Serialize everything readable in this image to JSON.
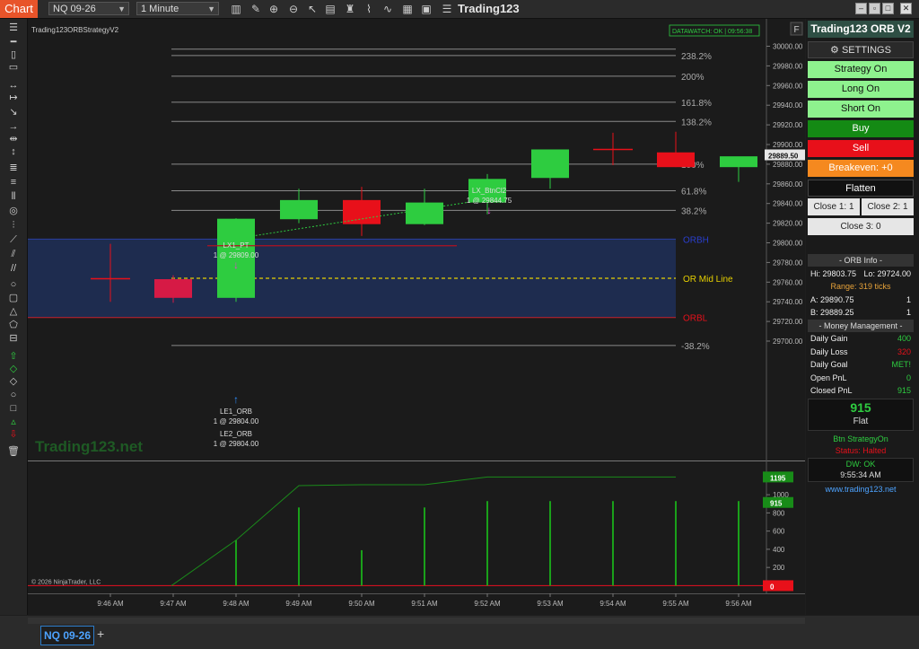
{
  "app": {
    "tab_label": "Chart",
    "instrument": "NQ 09-26",
    "interval": "1 Minute",
    "window_title": "Trading123",
    "toolbar_icons": [
      "bar-chart-icon",
      "pencil-icon",
      "zoom-in-icon",
      "zoom-out-icon",
      "cursor-icon",
      "properties-icon",
      "strategy-icon",
      "indicator-icon",
      "data-box-icon",
      "hide-icon",
      "list-icon"
    ],
    "window_buttons": [
      "–",
      "□",
      "▢",
      "✕"
    ]
  },
  "chart": {
    "indicator_label": "Trading123ORBStrategyV2",
    "datawatch": "DATAWATCH: OK | 09:56:38",
    "panel_f": "F",
    "watermark": "Trading123.net",
    "copyright": "© 2026 NinjaTrader, LLC",
    "price_ticks": [
      "30000.00",
      "29980.00",
      "29960.00",
      "29940.00",
      "29920.00",
      "29900.00",
      "29880.00",
      "29860.00",
      "29840.00",
      "29820.00",
      "29800.00",
      "29780.00",
      "29760.00",
      "29740.00",
      "29720.00",
      "29700.00"
    ],
    "last_price": "29889.50",
    "fib_levels": [
      {
        "label": "238.2%",
        "price": 29990.5
      },
      {
        "label": "200%",
        "price": 29969.5
      },
      {
        "label": "161.8%",
        "price": 29943.0
      },
      {
        "label": "138.2%",
        "price": 29923.5
      },
      {
        "label": "100%",
        "price": 29880.0
      },
      {
        "label": "61.8%",
        "price": 29853.0
      },
      {
        "label": "38.2%",
        "price": 29833.0
      },
      {
        "label": "-38.2%",
        "price": 29695.5
      }
    ],
    "or_labels": {
      "orh": "ORBH",
      "mid": "OR Mid Line",
      "orl": "ORBL"
    },
    "or_range": {
      "high": 29803.75,
      "low": 29724.0,
      "mid": 29763.9
    },
    "time_labels": [
      "9:46 AM",
      "9:47 AM",
      "9:48 AM",
      "9:49 AM",
      "9:50 AM",
      "9:51 AM",
      "9:52 AM",
      "9:53 AM",
      "9:54 AM",
      "9:55 AM",
      "9:56 AM"
    ],
    "candles": [
      {
        "t": "9:46 AM",
        "o": 29763.5,
        "h": 29799.0,
        "l": 29740.0,
        "c": 29763.5,
        "color": "doji"
      },
      {
        "t": "9:47 AM",
        "o": 29763.0,
        "h": 29767.0,
        "l": 29739.0,
        "c": 29744.0,
        "color": "red"
      },
      {
        "t": "9:48 AM",
        "o": 29744.0,
        "h": 29825.0,
        "l": 29740.0,
        "c": 29824.5,
        "color": "green"
      },
      {
        "t": "9:49 AM",
        "o": 29824.0,
        "h": 29855.0,
        "l": 29820.0,
        "c": 29843.5,
        "color": "green"
      },
      {
        "t": "9:50 AM",
        "o": 29843.5,
        "h": 29857.0,
        "l": 29807.0,
        "c": 29819.0,
        "color": "red"
      },
      {
        "t": "9:51 AM",
        "o": 29819.0,
        "h": 29855.0,
        "l": 29818.0,
        "c": 29841.0,
        "color": "green"
      },
      {
        "t": "9:52 AM",
        "o": 29841.0,
        "h": 29870.0,
        "l": 29829.0,
        "c": 29865.0,
        "color": "green"
      },
      {
        "t": "9:53 AM",
        "o": 29866.0,
        "h": 29895.0,
        "l": 29855.0,
        "c": 29895.0,
        "color": "green"
      },
      {
        "t": "9:54 AM",
        "o": 29895.0,
        "h": 29912.0,
        "l": 29879.0,
        "c": 29895.0,
        "color": "doji"
      },
      {
        "t": "9:55 AM",
        "o": 29892.0,
        "h": 29913.0,
        "l": 29877.0,
        "c": 29877.0,
        "color": "red"
      },
      {
        "t": "9:56 AM",
        "o": 29877.0,
        "h": 29887.0,
        "l": 29862.0,
        "c": 29888.0,
        "color": "green"
      }
    ],
    "trade_labels": {
      "lx1_title": "LX1_PT",
      "lx1_detail": "1 @ 29809.00",
      "lx_title": "LX_BtnCl2",
      "lx_detail": "1 @ 29844.75",
      "le1_title": "LE1_ORB",
      "le1_detail": "1 @ 29804.00",
      "le2_title": "LE2_ORB",
      "le2_detail": "1 @ 29804.00"
    },
    "pnl_ticks": [
      "1000",
      "800",
      "600",
      "400",
      "200"
    ],
    "pnl_badges": {
      "top": "1195",
      "cur": "915",
      "zero": "0"
    },
    "pnl_bars": [
      {
        "t": "9:48 AM",
        "v": 500
      },
      {
        "t": "9:49 AM",
        "v": 860
      },
      {
        "t": "9:50 AM",
        "v": 390
      },
      {
        "t": "9:51 AM",
        "v": 860
      },
      {
        "t": "9:52 AM",
        "v": 930
      },
      {
        "t": "9:53 AM",
        "v": 930
      },
      {
        "t": "9:54 AM",
        "v": 930
      },
      {
        "t": "9:55 AM",
        "v": 930
      },
      {
        "t": "9:56 AM",
        "v": 930
      }
    ]
  },
  "panel": {
    "title": "Trading123 ORB V2",
    "settings": "⚙ SETTINGS",
    "strategy_on": "Strategy On",
    "long_on": "Long On",
    "short_on": "Short On",
    "buy": "Buy",
    "sell": "Sell",
    "breakeven": "Breakeven: +0",
    "flatten": "Flatten",
    "close1": "Close 1: 1",
    "close2": "Close 2: 1",
    "close3": "Close 3:  0",
    "orb_info_title": "- ORB Info -",
    "hi": "Hi: 29803.75",
    "lo": "Lo: 29724.00",
    "range": "Range: 319 ticks",
    "a_label": "A: 29890.75",
    "a_val": "1",
    "b_label": "B: 29889.25",
    "b_val": "1",
    "mm_title": "- Money Management -",
    "daily_gain_l": "Daily Gain",
    "daily_gain_v": "400",
    "daily_loss_l": "Daily Loss",
    "daily_loss_v": "320",
    "daily_goal_l": "Daily Goal",
    "daily_goal_v": "MET!",
    "open_pnl_l": "Open PnL",
    "open_pnl_v": "0",
    "closed_pnl_l": "Closed PnL",
    "closed_pnl_v": "915",
    "big_pnl": "915",
    "position": "Flat",
    "btn_status": "Btn StrategyOn",
    "status_halted": "Status: Halted",
    "dw": "DW: OK",
    "clock": "9:55:34 AM",
    "url": "www.trading123.net"
  },
  "bottom": {
    "tab": "NQ 09-26",
    "add": "+"
  },
  "colors": {
    "green": "#2ecc40",
    "red": "#e8101a",
    "fib": "#8a8a8a",
    "or_fill": "#1f2f55",
    "mid": "#e6d000"
  }
}
